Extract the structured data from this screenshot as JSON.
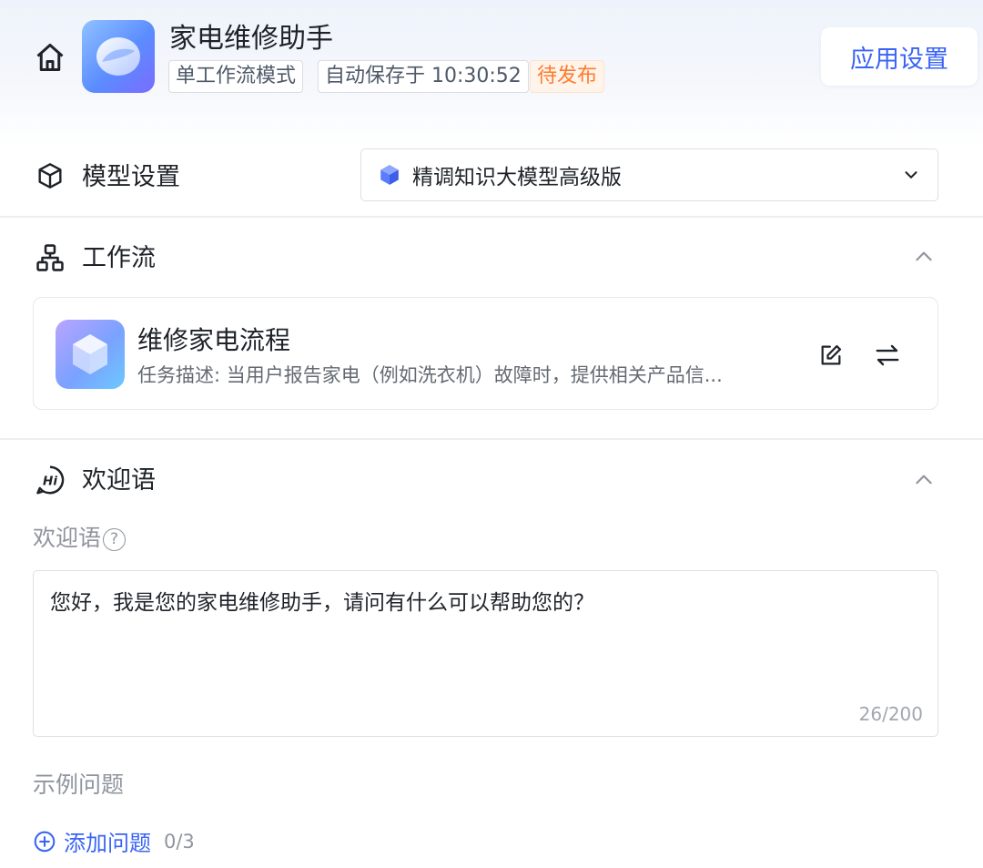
{
  "header": {
    "app_title": "家电维修助手",
    "tags": {
      "mode": "单工作流模式",
      "autosave": "自动保存于 10:30:52",
      "status": "待发布"
    },
    "settings_button": "应用设置",
    "icons": {
      "home": "home-icon",
      "logo": "app-logo"
    }
  },
  "model": {
    "section_title": "模型设置",
    "selected": "精调知识大模型高级版",
    "icons": {
      "section": "cube-icon",
      "option": "model-cube-icon",
      "dropdown": "chevron-down-icon"
    }
  },
  "workflow": {
    "section_title": "工作流",
    "card": {
      "name": "维修家电流程",
      "description": "任务描述: 当用户报告家电（例如洗衣机）故障时，提供相关产品信..."
    },
    "icons": {
      "section": "org-chart-icon",
      "edit": "edit-icon",
      "switch": "switch-icon",
      "collapse": "chevron-up-icon"
    }
  },
  "welcome": {
    "section_title": "欢迎语",
    "field_label": "欢迎语",
    "help_glyph": "?",
    "text": "您好，我是您的家电维修助手，请问有什么可以帮助您的？",
    "counter": "26/200",
    "example_label": "示例问题",
    "add_question": "添加问题",
    "question_count": "0/3",
    "icons": {
      "section": "hi-chat-icon",
      "add": "plus-circle-icon",
      "collapse": "chevron-up-icon"
    }
  },
  "colors": {
    "accent": "#3a64f6",
    "status_orange": "#ff7a2e",
    "text_primary": "#1f2329",
    "text_secondary": "#8f959e"
  }
}
